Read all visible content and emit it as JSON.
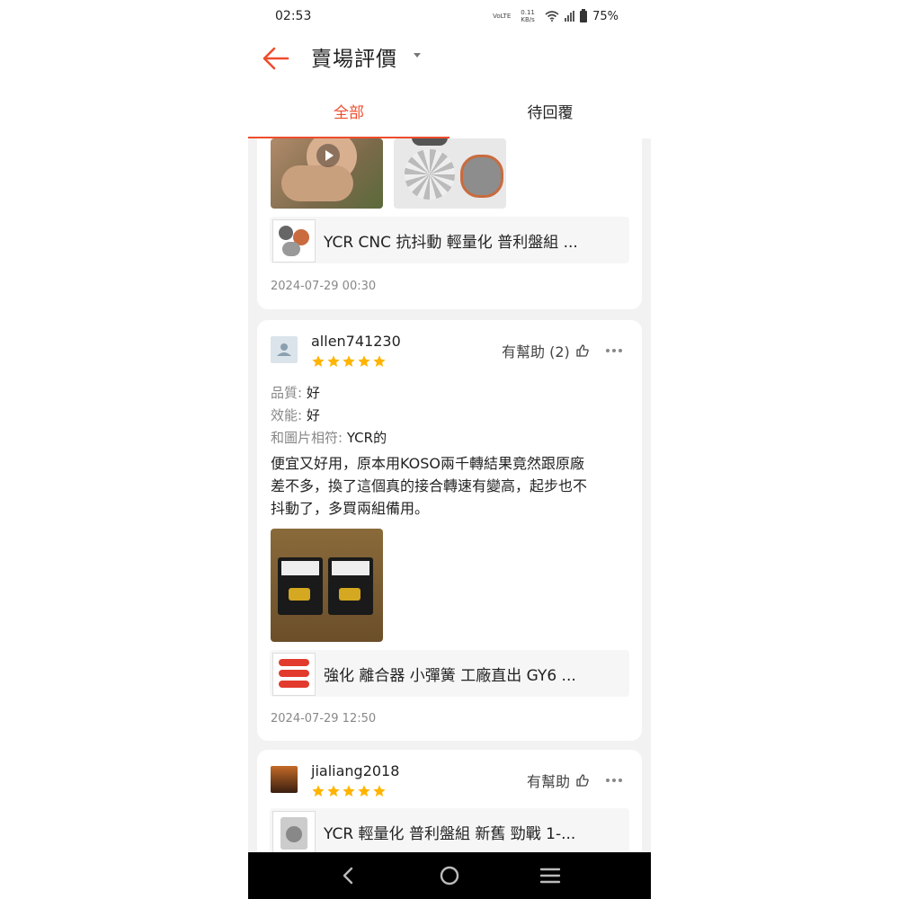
{
  "status_bar": {
    "time": "02:53",
    "volte": "VoLTE",
    "speed": "0.11 KB/s",
    "battery": "75%",
    "icons": [
      "wifi-icon",
      "signal-icon",
      "battery-icon"
    ]
  },
  "header": {
    "title": "賣場評價",
    "back_icon": "arrow-left-icon",
    "dropdown_icon": "caret-down-icon"
  },
  "tabs": [
    {
      "label": "全部",
      "active": true
    },
    {
      "label": "待回覆",
      "active": false
    }
  ],
  "colors": {
    "accent": "#ee4d2d",
    "star": "#ffb400"
  },
  "reviews": [
    {
      "product_name": "YCR CNC 抗抖動 輕量化 普利盤組 ...",
      "date": "2024-07-29 00:30",
      "media": [
        "video-thumbnail",
        "photo-thumbnail"
      ]
    },
    {
      "username": "allen741230",
      "rating": 5,
      "helpful": "有幫助 (2)",
      "attributes": [
        {
          "key": "品質: ",
          "value": "好"
        },
        {
          "key": "效能: ",
          "value": "好"
        },
        {
          "key": "和圖片相符: ",
          "value": "YCR的"
        }
      ],
      "text_lines": [
        "便宜又好用，原本用KOSO兩千轉結果竟然跟原廠",
        "差不多，換了這個真的接合轉速有變高，起步也不",
        "抖動了，多買兩組備用。"
      ],
      "product_name": "強化  離合器 小彈簧 工廠直出 GY6 ...",
      "date": "2024-07-29 12:50"
    },
    {
      "username": "jialiang2018",
      "rating": 5,
      "helpful": "有幫助",
      "product_name": "YCR 輕量化 普利盤組 新舊 勁戰 1-..."
    }
  ]
}
